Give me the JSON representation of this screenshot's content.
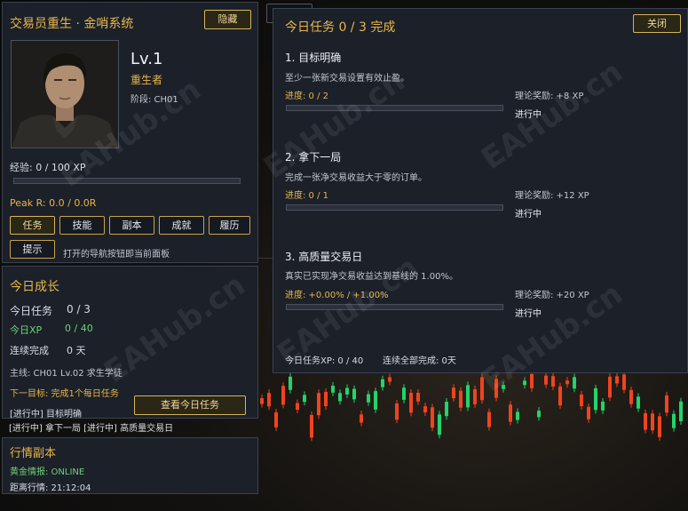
{
  "character_panel": {
    "title": "交易员重生 · 金哨系统",
    "hide_button": "隐藏",
    "level": "Lv.1",
    "class_name": "重生者",
    "stage": "阶段:  CH01",
    "exp_text": "经验:  0 / 100 XP",
    "exp_progress": 0,
    "peak_text": "Peak R:  0.0 / 0.0R",
    "nav": [
      "任务",
      "技能",
      "副本",
      "成就",
      "履历"
    ],
    "nav_active": 0,
    "tip_button": "提示",
    "tip_text": "打开的导航按钮即当前面板"
  },
  "growth_panel": {
    "title": "今日成长",
    "tasks_label": "今日任务",
    "tasks_value": "0 / 3",
    "xp_label": "今日XP",
    "xp_value": "0 / 40",
    "streak_label": "连续完成",
    "streak_value": "0 天",
    "mainline": "主线:  CH01 Lv.02 求生学徒",
    "next_goal": "下一目标:  完成1个每日任务",
    "view_button": "查看今日任务",
    "status_line1": "[进行中] 目标明确",
    "status_line2": "[进行中] 拿下一局   [进行中] 高质量交易日"
  },
  "market_panel": {
    "title": "行情副本",
    "intel": "黄金情报:  ONLINE",
    "distance": "距离行情:  21:12:04"
  },
  "task_panel": {
    "title": "今日任务  0 / 3 完成",
    "close_button": "关闭",
    "tasks": [
      {
        "name": "1. 目标明确",
        "desc": "至少一张新交易设置有效止盈。",
        "progress": "进度:  0 / 2",
        "fraction": 0,
        "reward": "理论奖励:  +8 XP",
        "status": "进行中"
      },
      {
        "name": "2. 拿下一局",
        "desc": "完成一张净交易收益大于零的订单。",
        "progress": "进度:  0 / 1",
        "fraction": 0,
        "reward": "理论奖励:  +12 XP",
        "status": "进行中"
      },
      {
        "name": "3. 高质量交易日",
        "desc": "真实已实现净交易收益达到基线的 1.00%。",
        "progress": "进度:  +0.00% / +1.00%",
        "fraction": 0,
        "reward": "理论奖励:  +20 XP",
        "status": "进行中"
      }
    ],
    "footer_xp": "今日任务XP:  0 / 40",
    "footer_streak": "连续全部完成:  0天"
  },
  "watermark": "EAHub.cn",
  "colors": {
    "gold": "#e8b64a",
    "green": "#6fd07a",
    "bull": "#22d46a",
    "bear": "#f0441e"
  }
}
